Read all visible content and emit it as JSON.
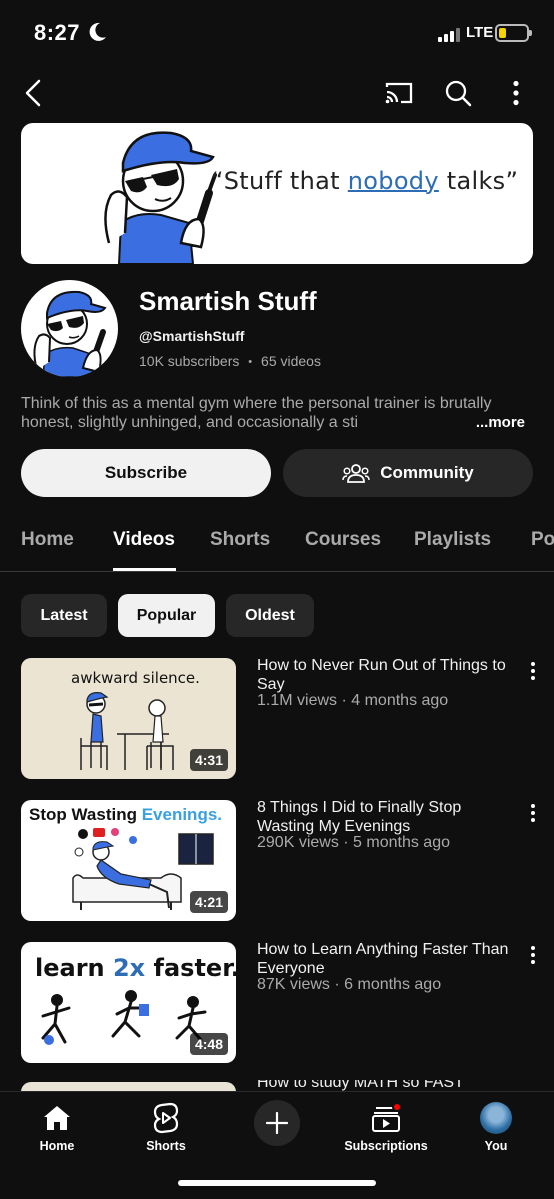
{
  "status_bar": {
    "time": "8:27",
    "network": "LTE",
    "battery_level": 0.25
  },
  "colors": {
    "background": "#0f0f0f",
    "accent_red": "#ff0000",
    "chip_bg": "#272727",
    "text_secondary": "#aaaaaa"
  },
  "icons": [
    "back-icon",
    "cast-icon",
    "search-icon",
    "more-vert-icon",
    "community-icon",
    "home-icon",
    "shorts-icon",
    "plus-icon",
    "subscriptions-icon"
  ],
  "banner": {
    "quote_before": "“Stuff that ",
    "quote_highlight": "nobody",
    "quote_after": " talks”"
  },
  "channel": {
    "name": "Smartish Stuff",
    "handle": "@SmartishStuff",
    "subscribers": "10K subscribers",
    "separator": "•",
    "videos": "65 videos",
    "description": "Think of this as a mental gym where the personal trainer is brutally honest, slightly unhinged, and occasionally a sti",
    "more_label": "...more"
  },
  "actions": {
    "subscribe": "Subscribe",
    "community": "Community"
  },
  "tabs": [
    {
      "label": "Home",
      "active": false
    },
    {
      "label": "Videos",
      "active": true
    },
    {
      "label": "Shorts",
      "active": false
    },
    {
      "label": "Courses",
      "active": false
    },
    {
      "label": "Playlists",
      "active": false
    },
    {
      "label": "Po",
      "active": false
    }
  ],
  "sort_chips": [
    {
      "label": "Latest",
      "active": false
    },
    {
      "label": "Popular",
      "active": true
    },
    {
      "label": "Oldest",
      "active": false
    }
  ],
  "videos": [
    {
      "title": "How to Never Run Out of Things to Say",
      "views": "1.1M views",
      "age": "4 months ago",
      "duration": "4:31",
      "thumb_text": "awkward silence."
    },
    {
      "title": "8 Things I Did to Finally Stop Wasting My Evenings",
      "views": "290K views",
      "age": "5 months ago",
      "duration": "4:21",
      "thumb_text_a": "Stop Wasting ",
      "thumb_text_b": "Evenings."
    },
    {
      "title": "How to Learn Anything Faster Than Everyone",
      "views": "87K views",
      "age": "6 months ago",
      "duration": "4:48",
      "thumb_text_a": "learn ",
      "thumb_text_b": "2x",
      "thumb_text_c": " faster."
    },
    {
      "title": "How to study MATH so FAST"
    }
  ],
  "meta_separator": " · ",
  "bottom_nav": {
    "home": "Home",
    "shorts": "Shorts",
    "subscriptions": "Subscriptions",
    "you": "You"
  }
}
